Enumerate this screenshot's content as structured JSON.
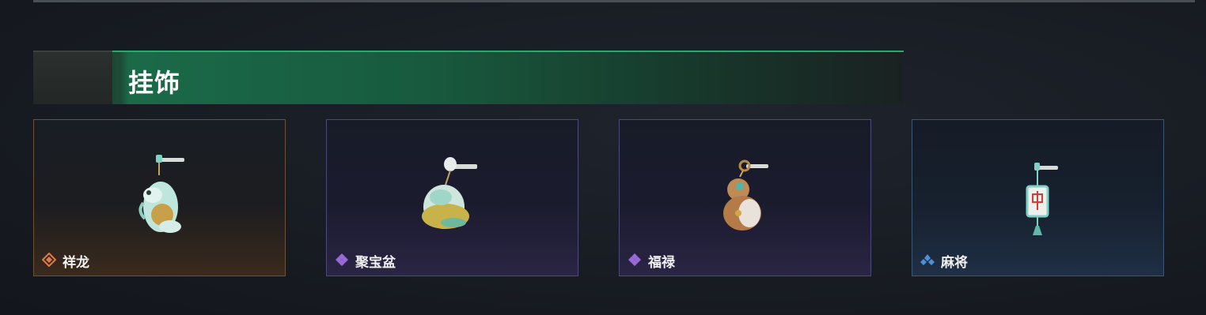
{
  "section": {
    "title": "挂饰"
  },
  "items": [
    {
      "name": "祥龙",
      "rarity_color": "#e07a4a",
      "icon": "dragon-charm-icon"
    },
    {
      "name": "聚宝盆",
      "rarity_color": "#9a6ad8",
      "icon": "treasure-bowl-charm-icon"
    },
    {
      "name": "福禄",
      "rarity_color": "#9a6ad8",
      "icon": "gourd-charm-icon"
    },
    {
      "name": "麻将",
      "rarity_color": "#4d8fd6",
      "icon": "mahjong-tile-charm-icon"
    }
  ]
}
